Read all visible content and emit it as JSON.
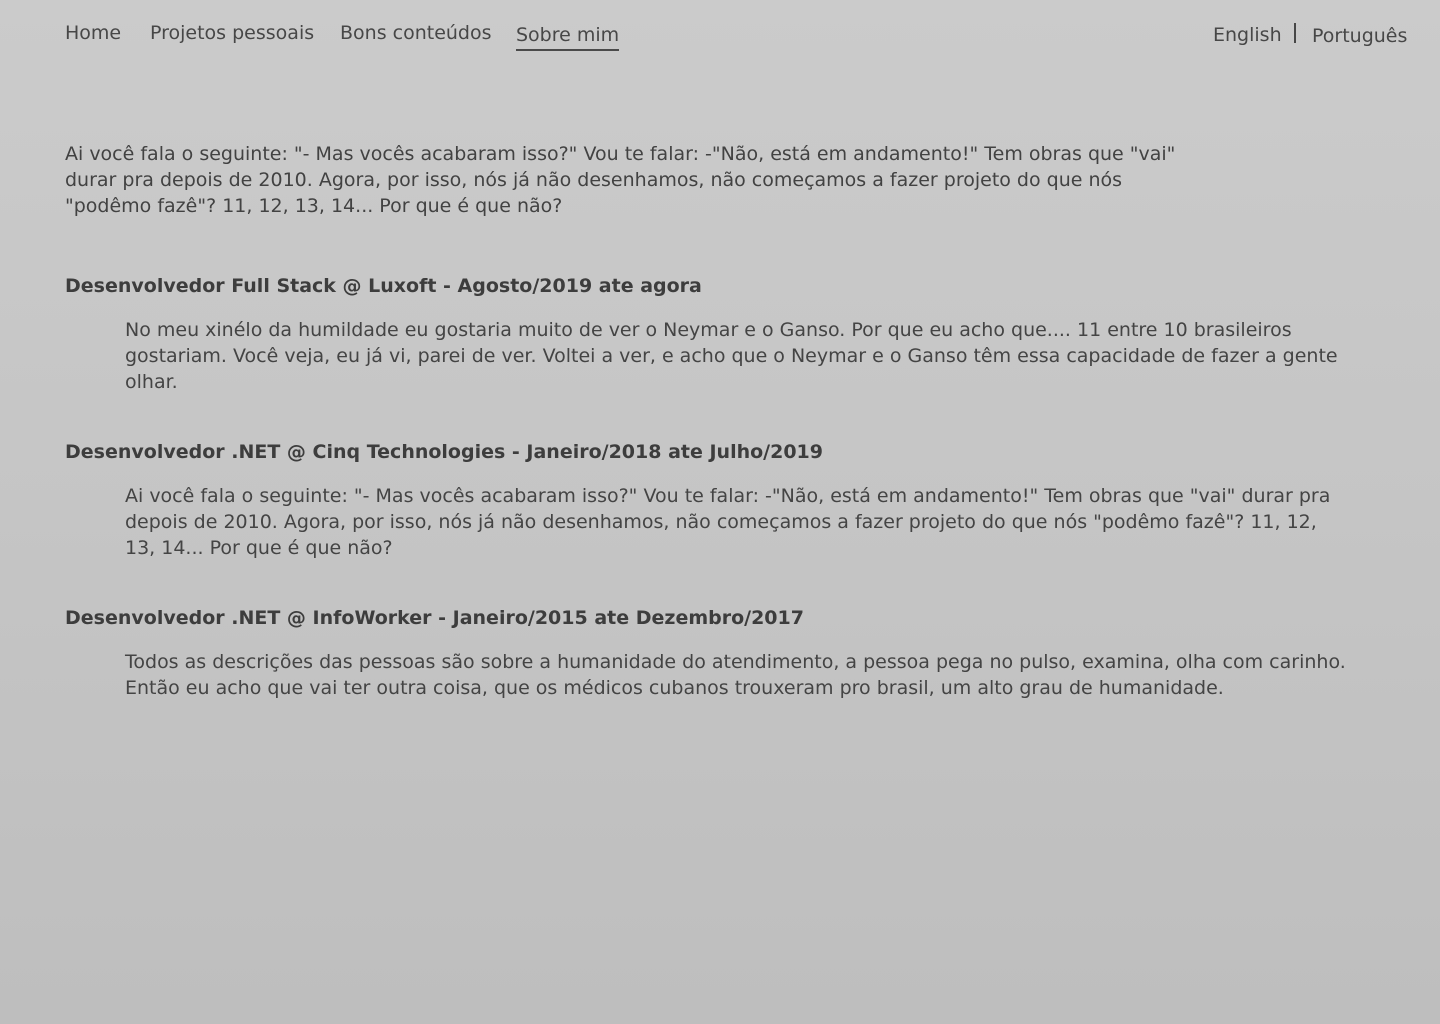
{
  "nav": {
    "items": [
      {
        "label": "Home"
      },
      {
        "label": "Projetos pessoais"
      },
      {
        "label": "Bons conteúdos"
      },
      {
        "label": "Sobre mim"
      }
    ],
    "active_label": "Sobre mim"
  },
  "languages": {
    "english": "English",
    "separator": "|",
    "portuguese": "Português"
  },
  "intro": "Ai você fala o seguinte: \"- Mas vocês acabaram isso?\" Vou te falar: -\"Não, está em andamento!\" Tem obras que \"vai\" durar pra depois de 2010. Agora, por isso, nós já não desenhamos, não começamos a fazer projeto do que nós \"podêmo fazê\"? 11, 12, 13, 14... Por que é que não?",
  "jobs": [
    {
      "title": "Desenvolvedor Full Stack @ Luxoft - Agosto/2019 ate agora",
      "description": "No meu xinélo da humildade eu gostaria muito de ver o Neymar e o Ganso. Por que eu acho que.... 11 entre 10 brasileiros gostariam. Você veja, eu já vi, parei de ver. Voltei a ver, e acho que o Neymar e o Ganso têm essa capacidade de fazer a gente olhar."
    },
    {
      "title": "Desenvolvedor .NET @ Cinq Technologies - Janeiro/2018 ate Julho/2019",
      "description": "Ai você fala o seguinte: \"- Mas vocês acabaram isso?\" Vou te falar: -\"Não, está em andamento!\" Tem obras que \"vai\" durar pra depois de 2010. Agora, por isso, nós já não desenhamos, não começamos a fazer projeto do que nós \"podêmo fazê\"? 11, 12, 13, 14... Por que é que não?"
    },
    {
      "title": "Desenvolvedor .NET @ InfoWorker - Janeiro/2015 ate Dezembro/2017",
      "description": "Todos as descrições das pessoas são sobre a humanidade do atendimento, a pessoa pega no pulso, examina, olha com carinho. Então eu acho que vai ter outra coisa, que os médicos cubanos trouxeram pro brasil, um alto grau de humanidade."
    }
  ]
}
